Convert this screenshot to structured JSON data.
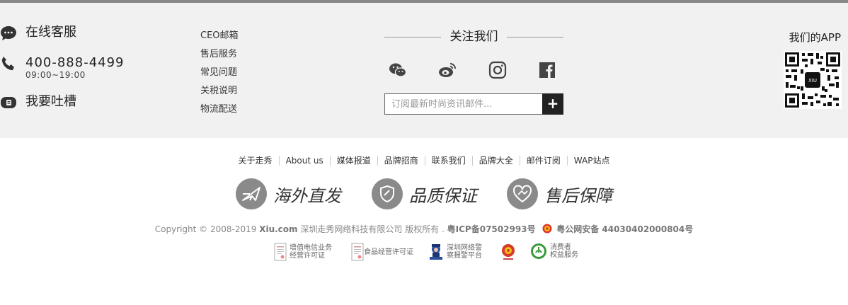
{
  "service": {
    "online": "在线客服",
    "phone": "400-888-4499",
    "hours": "09:00~19:00",
    "feedback": "我要吐槽"
  },
  "links": [
    "CEO邮箱",
    "售后服务",
    "常见问题",
    "关税说明",
    "物流配送"
  ],
  "follow": {
    "title": "关注我们",
    "icons": [
      "wechat-icon",
      "weibo-icon",
      "instagram-icon",
      "facebook-icon"
    ],
    "subscribe_placeholder": "订阅最新时尚资讯邮件...",
    "subscribe_button": "+"
  },
  "app": {
    "title": "我们的APP",
    "qr_label": "XIU"
  },
  "nav": [
    "关于走秀",
    "About us",
    "媒体报道",
    "品牌招商",
    "联系我们",
    "品牌大全",
    "邮件订阅",
    "WAP站点"
  ],
  "guarantees": [
    "海外直发",
    "品质保证",
    "售后保障"
  ],
  "copyright": {
    "prefix": "Copyright © 2008-2019",
    "brand": "Xiu.com",
    "company": "深圳走秀网络科技有限公司 版权所有 .",
    "icp": "粤ICP备07502993号",
    "police": "粤公网安备 44030402000804号"
  },
  "badges": [
    {
      "line1": "增值电信业务",
      "line2": "经营许可证"
    },
    {
      "line1": "食品经营许可证",
      "line2": ""
    },
    {
      "line1": "深圳网络警",
      "line2": "察报警平台"
    },
    {
      "line1": "",
      "line2": ""
    },
    {
      "line1": "消费者",
      "line2": "权益服务"
    }
  ],
  "colors": {
    "panel": "#f1f1f1",
    "button": "#222222",
    "icon_gray": "#8a8a8a"
  }
}
